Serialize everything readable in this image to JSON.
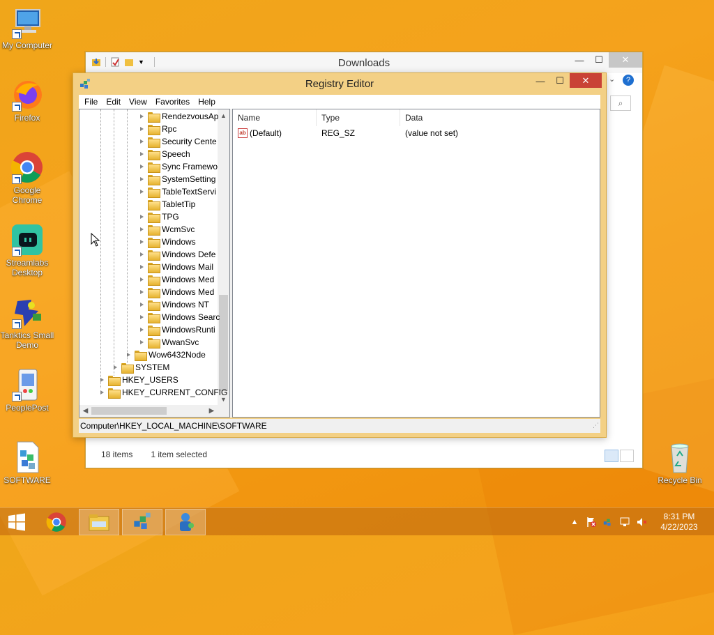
{
  "desktop": {
    "icons": [
      {
        "label": "My Computer",
        "icon": "my-computer-icon"
      },
      {
        "label": "Firefox",
        "icon": "firefox-icon"
      },
      {
        "label": "Google Chrome",
        "icon": "chrome-icon"
      },
      {
        "label": "Streamlabs Desktop",
        "icon": "streamlabs-icon"
      },
      {
        "label": "Tanktics Small Demo",
        "icon": "tanktics-icon"
      },
      {
        "label": "PeoplePost",
        "icon": "peoplepost-icon"
      },
      {
        "label": "SOFTWARE",
        "icon": "registry-file-icon"
      },
      {
        "label": "Recycle Bin",
        "icon": "recycle-bin-icon"
      }
    ]
  },
  "downloads": {
    "title": "Downloads",
    "status": {
      "items": "18 items",
      "selected": "1 item selected"
    }
  },
  "regedit": {
    "title": "Registry Editor",
    "menu": [
      "File",
      "Edit",
      "View",
      "Favorites",
      "Help"
    ],
    "tree": [
      {
        "label": "RendezvousAp",
        "level": 4,
        "expandable": true
      },
      {
        "label": "Rpc",
        "level": 4,
        "expandable": true
      },
      {
        "label": "Security Cente",
        "level": 4,
        "expandable": true
      },
      {
        "label": "Speech",
        "level": 4,
        "expandable": true
      },
      {
        "label": "Sync Framewo",
        "level": 4,
        "expandable": true
      },
      {
        "label": "SystemSetting",
        "level": 4,
        "expandable": true
      },
      {
        "label": "TableTextServi",
        "level": 4,
        "expandable": true
      },
      {
        "label": "TabletTip",
        "level": 4,
        "expandable": false
      },
      {
        "label": "TPG",
        "level": 4,
        "expandable": true
      },
      {
        "label": "WcmSvc",
        "level": 4,
        "expandable": true
      },
      {
        "label": "Windows",
        "level": 4,
        "expandable": true
      },
      {
        "label": "Windows Defe",
        "level": 4,
        "expandable": true
      },
      {
        "label": "Windows Mail",
        "level": 4,
        "expandable": true
      },
      {
        "label": "Windows Med",
        "level": 4,
        "expandable": true
      },
      {
        "label": "Windows Med",
        "level": 4,
        "expandable": true
      },
      {
        "label": "Windows NT",
        "level": 4,
        "expandable": true
      },
      {
        "label": "Windows Searc",
        "level": 4,
        "expandable": true
      },
      {
        "label": "WindowsRunti",
        "level": 4,
        "expandable": true
      },
      {
        "label": "WwanSvc",
        "level": 4,
        "expandable": true
      },
      {
        "label": "Wow6432Node",
        "level": 3,
        "expandable": true
      },
      {
        "label": "SYSTEM",
        "level": 2,
        "expandable": true
      },
      {
        "label": "HKEY_USERS",
        "level": 1,
        "expandable": true
      },
      {
        "label": "HKEY_CURRENT_CONFIG",
        "level": 1,
        "expandable": true
      }
    ],
    "columns": {
      "name": "Name",
      "type": "Type",
      "data": "Data"
    },
    "values": [
      {
        "name": "(Default)",
        "type": "REG_SZ",
        "data": "(value not set)"
      }
    ],
    "status_path": "Computer\\HKEY_LOCAL_MACHINE\\SOFTWARE"
  },
  "taskbar": {
    "buttons": [
      "chrome-icon",
      "file-explorer-icon",
      "regedit-icon",
      "network-app-icon"
    ],
    "clock": {
      "time": "8:31 PM",
      "date": "4/22/2023"
    }
  }
}
